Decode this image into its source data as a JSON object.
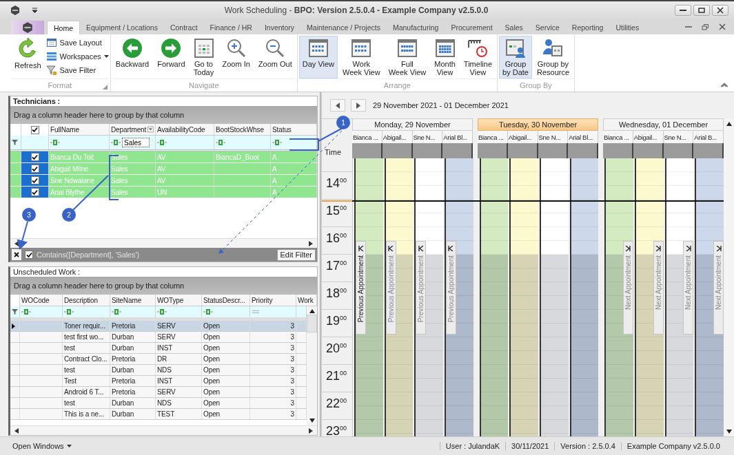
{
  "window": {
    "title": "Work Scheduling - **BPO: Version 2.5.0.4 - Example Company v2.5.0.0**"
  },
  "menu_tabs": [
    {
      "label": "Home",
      "selected": true
    },
    {
      "label": "Equipment / Locations",
      "selected": false
    },
    {
      "label": "Contract",
      "selected": false
    },
    {
      "label": "Finance / HR",
      "selected": false
    },
    {
      "label": "Inventory",
      "selected": false
    },
    {
      "label": "Maintenance / Projects",
      "selected": false
    },
    {
      "label": "Manufacturing",
      "selected": false
    },
    {
      "label": "Procurement",
      "selected": false
    },
    {
      "label": "Sales",
      "selected": false
    },
    {
      "label": "Service",
      "selected": false
    },
    {
      "label": "Reporting",
      "selected": false
    },
    {
      "label": "Utilities",
      "selected": false
    }
  ],
  "ribbon": [
    {
      "label": "Format",
      "items": [
        {
          "kind": "large",
          "label": "Refresh"
        },
        {
          "kind": "small",
          "label": "Save Layout"
        },
        {
          "kind": "small-menu",
          "label": "Workspaces"
        },
        {
          "kind": "small",
          "label": "Save Filter"
        }
      ]
    },
    {
      "label": "Navigate",
      "items": [
        {
          "kind": "large",
          "label": "Backward"
        },
        {
          "kind": "large",
          "label": "Forward"
        },
        {
          "kind": "large",
          "label": "Go to\nToday"
        },
        {
          "kind": "large",
          "label": "Zoom In"
        },
        {
          "kind": "large",
          "label": "Zoom Out"
        }
      ]
    },
    {
      "label": "Arrange",
      "items": [
        {
          "kind": "toggle",
          "label": "Day View",
          "selected": true
        },
        {
          "kind": "toggle",
          "label": "Work\nWeek View",
          "selected": false
        },
        {
          "kind": "toggle",
          "label": "Full\nWeek View",
          "selected": false
        },
        {
          "kind": "toggle",
          "label": "Month\nView",
          "selected": false
        },
        {
          "kind": "toggle",
          "label": "Timeline\nView",
          "selected": false
        }
      ]
    },
    {
      "label": "Group By",
      "items": [
        {
          "kind": "toggle",
          "label": "Group\nby Date",
          "selected": true
        },
        {
          "kind": "toggle",
          "label": "Group by\nResource",
          "selected": false
        }
      ]
    }
  ],
  "technicians": {
    "title": "Technicians :",
    "group_hint": "Drag a column header here to group by that column",
    "header_checked": true,
    "columns": [
      {
        "label": "FullName",
        "filtered": false
      },
      {
        "label": "Department",
        "filtered": true,
        "filter": "Sales"
      },
      {
        "label": "AvailabilityCode",
        "filtered": false
      },
      {
        "label": "BootStockWhse",
        "filtered": false
      },
      {
        "label": "Status",
        "filtered": false
      }
    ],
    "rows": [
      {
        "checked": true,
        "selected": true,
        "name": "Bianca Du Toit",
        "department": "Sales",
        "availability": "AV",
        "boot_stock": "BiancaD_Boot",
        "status": "A"
      },
      {
        "checked": true,
        "selected": true,
        "name": "Abigail Milne",
        "department": "Sales",
        "availability": "AV",
        "status": "A"
      },
      {
        "checked": true,
        "selected": true,
        "name": "Sne Ndwalane",
        "department": "Sales",
        "availability": "AV",
        "status": "A"
      },
      {
        "checked": true,
        "selected": true,
        "name": "Arial Blythe",
        "department": "Sales",
        "availability": "UN",
        "status": "A"
      }
    ],
    "filter_panel": {
      "enabled": true,
      "expression": "Contains([Department], 'Sales')",
      "edit_button": "Edit Filter"
    }
  },
  "unscheduled": {
    "title": "Unscheduled Work :",
    "group_hint": "Drag a column header here to group by that column",
    "columns": [
      {
        "label": "WOCode",
        "kind": "text"
      },
      {
        "label": "Description",
        "kind": "text"
      },
      {
        "label": "SiteName",
        "kind": "text"
      },
      {
        "label": "WOType",
        "kind": "text"
      },
      {
        "label": "StatusDescr...",
        "kind": "text"
      },
      {
        "label": "Priority",
        "kind": "number"
      },
      {
        "label": "Work"
      }
    ],
    "rows": [
      {
        "selected": true,
        "cells": [
          "",
          "Toner requir...",
          "Pretoria",
          "SERV",
          "Open",
          "3"
        ]
      },
      {
        "selected": false,
        "cells": [
          "",
          "test first wo...",
          "Durban",
          "SERV",
          "Open",
          "3"
        ]
      },
      {
        "selected": false,
        "cells": [
          "",
          "test",
          "Durban",
          "INST",
          "Open",
          "3"
        ]
      },
      {
        "selected": false,
        "cells": [
          "",
          "Contract Clo...",
          "Pretoria",
          "DR",
          "Open",
          "3"
        ]
      },
      {
        "selected": false,
        "cells": [
          "",
          "test",
          "Durban",
          "NDS",
          "Open",
          "3"
        ]
      },
      {
        "selected": false,
        "cells": [
          "",
          "Test",
          "Pretoria",
          "INST",
          "Open",
          "3"
        ]
      },
      {
        "selected": false,
        "cells": [
          "",
          "Android 6 T...",
          "Pretoria",
          "SERV",
          "Open",
          "3"
        ]
      },
      {
        "selected": false,
        "cells": [
          "",
          "test",
          "Durban",
          "NDS",
          "Open",
          "3"
        ]
      },
      {
        "selected": false,
        "cells": [
          "",
          "This is a ne...",
          "Durban",
          "TEST",
          "Open",
          "3"
        ]
      }
    ]
  },
  "calendar": {
    "range": "29 November 2021 - 01 December 2021",
    "time_label": "Time",
    "days": [
      {
        "label": "Monday, 29 November",
        "today": false,
        "resources": [
          {
            "name": "Bianca ...",
            "color": "#d4ebc2"
          },
          {
            "name": "Abigail...",
            "color": "#fdf9cf"
          },
          {
            "name": "Sne N...",
            "color": "#ffffff"
          },
          {
            "name": "Arial Bl...",
            "color": "#cdd8ea"
          }
        ]
      },
      {
        "label": "Tuesday, 30 November",
        "today": true,
        "resources": [
          {
            "name": "Bianca ...",
            "color": "#d4ebc2"
          },
          {
            "name": "Abigail...",
            "color": "#fdf9cf"
          },
          {
            "name": "Sne N...",
            "color": "#ffffff"
          },
          {
            "name": "Arial Bl...",
            "color": "#cdd8ea"
          }
        ]
      },
      {
        "label": "Wednesday, 01 December",
        "today": false,
        "resources": [
          {
            "name": "Bianca ...",
            "color": "#d4ebc2"
          },
          {
            "name": "Abigail...",
            "color": "#fdf9cf"
          },
          {
            "name": "Sne N...",
            "color": "#ffffff"
          },
          {
            "name": "Arial B...",
            "color": "#cdd8ea"
          }
        ]
      }
    ],
    "hours": [
      "14$^{00}$",
      "15$^{00}$",
      "16$^{00}$",
      "17$^{00}$",
      "18$^{00}$",
      "19$^{00}$",
      "20$^{00}$",
      "21$^{00}$",
      "22$^{00}$",
      "23$^{00}$"
    ],
    "prev_buttons": [
      {
        "label": "Previous Appointment",
        "disabled": false
      },
      {
        "label": "Previous Appointment",
        "disabled": true
      },
      {
        "label": "Previous Appointment",
        "disabled": true
      },
      {
        "label": "Previous Appointment",
        "disabled": true
      }
    ],
    "next_buttons": [
      {
        "label": "Next Appointment",
        "disabled": true
      },
      {
        "label": "Next Appointment",
        "disabled": true
      },
      {
        "label": "Next Appointment",
        "disabled": true
      },
      {
        "label": "Next Appointment",
        "disabled": true
      }
    ]
  },
  "annotations": [
    {
      "number": "1"
    },
    {
      "number": "2"
    },
    {
      "number": "3"
    }
  ],
  "status_bar": {
    "open_windows": "Open Windows",
    "fields": [
      "User : JulandaK",
      "30/11/2021",
      "Version : 2.5.0.4",
      "Example Company v2.5.0.0"
    ]
  }
}
